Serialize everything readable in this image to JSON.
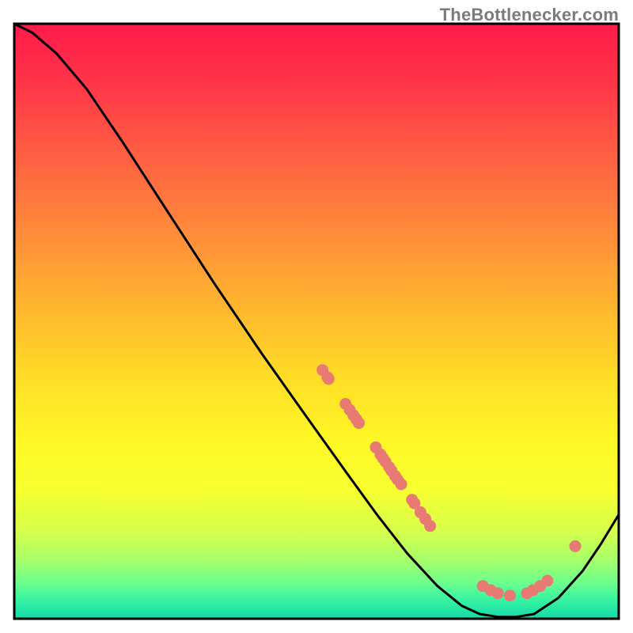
{
  "watermark": "TheBottlenecker.com",
  "chart_data": {
    "type": "line",
    "title": "",
    "xlabel": "",
    "ylabel": "",
    "xlim": [
      0,
      100
    ],
    "ylim": [
      0,
      100
    ],
    "curve": [
      {
        "x": 0,
        "y": 100
      },
      {
        "x": 3,
        "y": 98.5
      },
      {
        "x": 7,
        "y": 95
      },
      {
        "x": 12,
        "y": 89
      },
      {
        "x": 18,
        "y": 80
      },
      {
        "x": 25,
        "y": 69
      },
      {
        "x": 33,
        "y": 56.5
      },
      {
        "x": 41,
        "y": 44.5
      },
      {
        "x": 49,
        "y": 33
      },
      {
        "x": 55,
        "y": 24.5
      },
      {
        "x": 60,
        "y": 17.5
      },
      {
        "x": 65,
        "y": 11
      },
      {
        "x": 70,
        "y": 5.5
      },
      {
        "x": 74,
        "y": 2.2
      },
      {
        "x": 77,
        "y": 0.8
      },
      {
        "x": 80,
        "y": 0.3
      },
      {
        "x": 83,
        "y": 0.3
      },
      {
        "x": 86,
        "y": 0.8
      },
      {
        "x": 90,
        "y": 3.5
      },
      {
        "x": 94,
        "y": 8
      },
      {
        "x": 97,
        "y": 12.5
      },
      {
        "x": 100,
        "y": 17.5
      }
    ],
    "scatter_points": [
      {
        "x": 51.0,
        "y": 41.8
      },
      {
        "x": 51.8,
        "y": 40.6
      },
      {
        "x": 52.0,
        "y": 40.3
      },
      {
        "x": 54.8,
        "y": 36.1
      },
      {
        "x": 55.5,
        "y": 35.1
      },
      {
        "x": 56.1,
        "y": 34.2
      },
      {
        "x": 56.6,
        "y": 33.5
      },
      {
        "x": 57.0,
        "y": 32.9
      },
      {
        "x": 59.8,
        "y": 28.8
      },
      {
        "x": 60.6,
        "y": 27.6
      },
      {
        "x": 61.0,
        "y": 27.0
      },
      {
        "x": 61.4,
        "y": 26.4
      },
      {
        "x": 62.0,
        "y": 25.5
      },
      {
        "x": 62.4,
        "y": 24.9
      },
      {
        "x": 63.0,
        "y": 24.0
      },
      {
        "x": 63.4,
        "y": 23.4
      },
      {
        "x": 64.0,
        "y": 22.6
      },
      {
        "x": 65.8,
        "y": 20.0
      },
      {
        "x": 66.2,
        "y": 19.4
      },
      {
        "x": 67.2,
        "y": 17.9
      },
      {
        "x": 68.0,
        "y": 16.8
      },
      {
        "x": 68.8,
        "y": 15.6
      },
      {
        "x": 77.5,
        "y": 5.5
      },
      {
        "x": 78.8,
        "y": 4.8
      },
      {
        "x": 80.0,
        "y": 4.3
      },
      {
        "x": 82.0,
        "y": 3.9
      },
      {
        "x": 84.8,
        "y": 4.3
      },
      {
        "x": 85.8,
        "y": 4.8
      },
      {
        "x": 87.0,
        "y": 5.5
      },
      {
        "x": 88.2,
        "y": 6.4
      },
      {
        "x": 92.8,
        "y": 12.2
      }
    ],
    "series": [
      {
        "name": "curve",
        "type": "line",
        "color": "#000000"
      },
      {
        "name": "points",
        "type": "scatter",
        "color": "#e77a72"
      }
    ],
    "gradient_stops": [
      {
        "offset": 0.0,
        "color": "#ff1a4a"
      },
      {
        "offset": 0.1,
        "color": "#ff3548"
      },
      {
        "offset": 0.2,
        "color": "#ff5844"
      },
      {
        "offset": 0.3,
        "color": "#ff7a3e"
      },
      {
        "offset": 0.4,
        "color": "#ff9c36"
      },
      {
        "offset": 0.5,
        "color": "#ffbe2c"
      },
      {
        "offset": 0.6,
        "color": "#ffde26"
      },
      {
        "offset": 0.7,
        "color": "#fff726"
      },
      {
        "offset": 0.78,
        "color": "#f8ff2e"
      },
      {
        "offset": 0.85,
        "color": "#d8ff4a"
      },
      {
        "offset": 0.9,
        "color": "#a8ff68"
      },
      {
        "offset": 0.94,
        "color": "#6cff8e"
      },
      {
        "offset": 0.97,
        "color": "#34f2a2"
      },
      {
        "offset": 1.0,
        "color": "#14d8a8"
      }
    ]
  }
}
